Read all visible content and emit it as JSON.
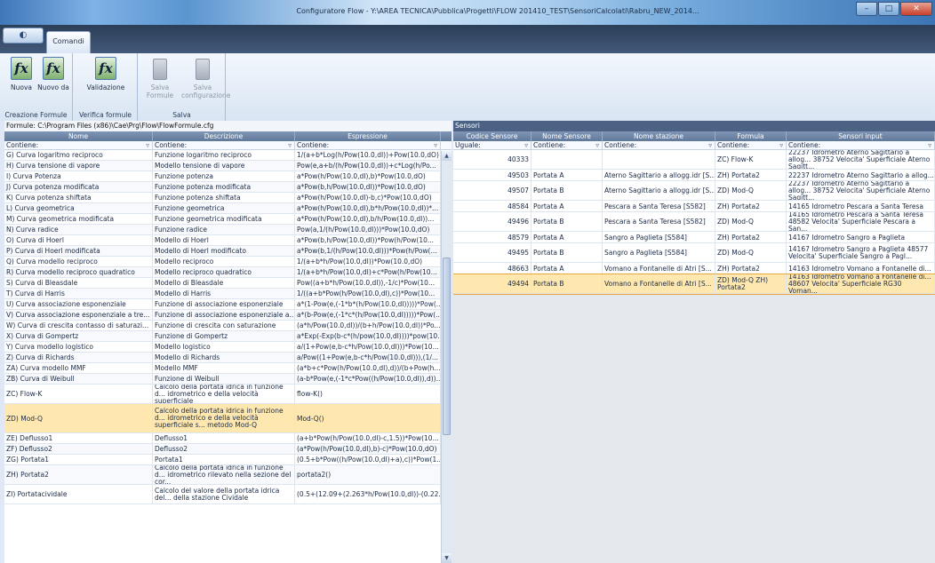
{
  "window": {
    "title": "Configuratore Flow - Y:\\AREA TECNICA\\Pubblica\\Progetti\\FLOW 201410_TEST\\SensoriCalcolati\\Rabru_NEW_2014...",
    "minimize": "–",
    "maximize": "□",
    "close": "✕"
  },
  "tabs": {
    "orb": "◐",
    "comandi": "Comandi"
  },
  "ribbon": {
    "groups": [
      {
        "label": "Creazione Formule",
        "buttons": [
          "Nuova",
          "Nuovo da"
        ]
      },
      {
        "label": "Verifica formule",
        "buttons": [
          "Validazione"
        ]
      },
      {
        "label": "Salva",
        "buttons": [
          "Salva Formule",
          "Salva configurazione"
        ]
      }
    ],
    "icon_glyph": "fx"
  },
  "left": {
    "path": "Formule: C:\\Program Files (x86)\\Cae\\Prg\\Flow\\FlowFormule.cfg",
    "columns": [
      "Nome",
      "Descrizione",
      "Espressione"
    ],
    "filter": "Contiene:",
    "rows": [
      {
        "nome": "G) Curva logaritmo reciproco",
        "desc": "Funzione logaritmo reciproco",
        "expr": "1/(a+b*Log(h/Pow(10.0,dI))+Pow(10.0,dO)"
      },
      {
        "nome": "H) Curva tensione di vapore",
        "desc": "Modello tensione di vapore",
        "expr": "Pow(e,a+b/(h/Pow(10.0,dI))+c*Log(h/Po..."
      },
      {
        "nome": "I) Curva Potenza",
        "desc": "Funzione potenza",
        "expr": "a*Pow(h/Pow(10.0,dI),b)*Pow(10.0,dO)"
      },
      {
        "nome": "J) Curva potenza modificata",
        "desc": "Funzione potenza modificata",
        "expr": "a*Pow(b,h/Pow(10.0,dI))*Pow(10.0,dO)"
      },
      {
        "nome": "K) Curva potenza shiftata",
        "desc": "Funzione potenza shiftata",
        "expr": "a*Pow(h/Pow(10.0,dI)-b,c)*Pow(10.0,dO)"
      },
      {
        "nome": "L) Curva geometrica",
        "desc": "Funzione geometrica",
        "expr": "a*Pow(h/Pow(10.0,dI),b*h/Pow(10.0,dI))*..."
      },
      {
        "nome": "M) Curva geometrica modificata",
        "desc": "Funzione geometrica modificata",
        "expr": "a*Pow(h/Pow(10.0,dI),b/h/Pow(10.0,dI))..."
      },
      {
        "nome": "N) Curva radice",
        "desc": "Funzione radice",
        "expr": "Pow(a,1/(h/Pow(10.0,dI)))*Pow(10.0,dO)"
      },
      {
        "nome": "O) Curva di Hoerl",
        "desc": "Modello di Hoerl",
        "expr": "a*Pow(b,h/Pow(10.0,dI))*Pow(h/Pow(10..."
      },
      {
        "nome": "P) Curva di Hoerl modificata",
        "desc": "Modello di Hoerl modificato",
        "expr": "a*Pow(b,1/(h/Pow(10.0,dI)))*Pow(h/Pow(..."
      },
      {
        "nome": "Q) Curva modello reciproco",
        "desc": "Modello reciproco",
        "expr": "1/(a+b*h/Pow(10.0,dI))*Pow(10.0,dO)"
      },
      {
        "nome": "R) Curva modello reciproco quadratico",
        "desc": "Modello reciproco quadratico",
        "expr": "1/(a+b*h/Pow(10.0,dI)+c*Pow(h/Pow(10..."
      },
      {
        "nome": "S) Curva di Bleasdale",
        "desc": "Modello di Bleasdale",
        "expr": "Pow((a+b*h/Pow(10.0,dI)),-1/c)*Pow(10..."
      },
      {
        "nome": "T) Curva di Harris",
        "desc": "Modello di Harris",
        "expr": "1/((a+b*Pow(h/Pow(10.0,dI),c))*Pow(10..."
      },
      {
        "nome": "U) Curva associazione esponenziale",
        "desc": "Funzione di associazione esponenziale",
        "expr": "a*(1-Pow(e,(-1*b*(h/Pow(10.0,dI)))))*Pow(..."
      },
      {
        "nome": "V) Curva associazione esponenziale a tre...",
        "desc": "Funzione di associazione esponenziale a...",
        "expr": "a*(b-Pow(e,(-1*c*(h/Pow(10.0,dI)))))*Pow(..."
      },
      {
        "nome": "W) Curva di crescita contasso di saturazi...",
        "desc": "Funzione di crescita con saturazione",
        "expr": "(a*h/Pow(10.0,dI))/(b+h/Pow(10.0,dI))*Po..."
      },
      {
        "nome": "X) Curva di Gompertz",
        "desc": "Funzione di Gompertz",
        "expr": "a*Exp(-Exp(b-c*(h/pow(10.0,dI))))*pow(10..."
      },
      {
        "nome": "Y) Curva modello logistico",
        "desc": "Modello logistico",
        "expr": "a/(1+Pow(e,b-c*h/Pow(10.0,dI)))*Pow(10..."
      },
      {
        "nome": "Z) Curva di Richards",
        "desc": "Modello di Richards",
        "expr": "a/Pow((1+Pow(e,b-c*h/Pow(10.0,dI))),(1/..."
      },
      {
        "nome": "ZA) Curva modello MMF",
        "desc": "Modello MMF",
        "expr": "(a*b+c*Pow(h/Pow(10.0,dI),d))/(b+Pow(h..."
      },
      {
        "nome": "ZB) Curva di Weibull",
        "desc": "Funzione di Weibull",
        "expr": "(a-b*Pow(e,(-1*c*Pow((h/Pow(10.0,dI)),d))..."
      },
      {
        "nome": "ZC) Flow-K",
        "desc": "Calcolo della portata idrica in funzione d... idrometrico e della velocità superficiale",
        "expr": "flow-K()",
        "tall": 2
      },
      {
        "nome": "ZD) Mod-Q",
        "desc": "Calcolo della portata idrica in funzione d... idrometrico e della velocità superficiale s... metodo Mod-Q",
        "expr": "Mod-Q()",
        "tall": 3,
        "sel": true
      },
      {
        "nome": "ZE) Deflusso1",
        "desc": "Deflusso1",
        "expr": "(a+b*Pow(h/Pow(10.0,dI)-c,1.5))*Pow(10..."
      },
      {
        "nome": "ZF) Deflusso2",
        "desc": "Deflusso2",
        "expr": "(a*Pow(h/Pow(10.0,dI),b)-c)*Pow(10.0,dO)"
      },
      {
        "nome": "ZG) Portata1",
        "desc": "Portata1",
        "expr": "(0.5+b*Pow((h/Pow(10.0,dI)+a),c))*Pow(1..."
      },
      {
        "nome": "ZH) Portata2",
        "desc": "Calcolo della portata idrica in funzione d... idrometrico rilevato nella sezione del cor...",
        "expr": "portata2()",
        "tall": 2
      },
      {
        "nome": "ZI) Portatacividale",
        "desc": "Calcolo del valore della portata idrica del... della stazione Cividale",
        "expr": "(0.5+(12.09+(2.263*h/Pow(10.0,dI))-(0.22...",
        "tall": 2
      }
    ]
  },
  "right": {
    "title": "Sensori",
    "columns": [
      "Codice Sensore",
      "Nome Sensore",
      "Nome stazione",
      "Formula",
      "Sensori input"
    ],
    "filter": [
      "Uguale:",
      "Contiene:",
      "Contiene:",
      "Contiene:",
      "Contiene:"
    ],
    "rows": [
      {
        "code": "40333",
        "nome": "",
        "stazione": "",
        "formula": "ZC) Flow-K",
        "input": "22237 Idrometro Aterno Sagittario a allog... 38752 Velocita' Superficiale Aterno Sagitt..."
      },
      {
        "code": "49503",
        "nome": "Portata A",
        "stazione": "Aterno Sagittario a allogg.idr [S...",
        "formula": "ZH) Portata2",
        "input": "22237 Idrometro Aterno Sagittario a allog..."
      },
      {
        "code": "49507",
        "nome": "Portata B",
        "stazione": "Aterno Sagittario a allogg.idr [S...",
        "formula": "ZD) Mod-Q",
        "input": "22237 Idrometro Aterno Sagittario a allog... 38752 Velocita' Superficiale Aterno Sagitt..."
      },
      {
        "code": "48584",
        "nome": "Portata A",
        "stazione": "Pescara a Santa Teresa [S582]",
        "formula": "ZH) Portata2",
        "input": "14165 Idrometro Pescara a Santa Teresa"
      },
      {
        "code": "49496",
        "nome": "Portata B",
        "stazione": "Pescara a Santa Teresa [S582]",
        "formula": "ZD) Mod-Q",
        "input": "14165 Idrometro Pescara a Santa Teresa 48582 Velocita' Superficiale Pescara a San..."
      },
      {
        "code": "48579",
        "nome": "Portata A",
        "stazione": "Sangro a Paglieta [S584]",
        "formula": "ZH) Portata2",
        "input": "14167 Idrometro Sangro a Paglieta"
      },
      {
        "code": "49495",
        "nome": "Portata B",
        "stazione": "Sangro a Paglieta [S584]",
        "formula": "ZD) Mod-Q",
        "input": "14167 Idrometro Sangro a Paglieta 48577 Velocita' Superficiale Sangro a Pagl..."
      },
      {
        "code": "48663",
        "nome": "Portata A",
        "stazione": "Vomano a Fontanelle di Atri [S...",
        "formula": "ZH) Portata2",
        "input": "14163 Idrometro Vomano a Fontanelle di..."
      },
      {
        "code": "49494",
        "nome": "Portata B",
        "stazione": "Vomano a Fontanelle di Atri [S...",
        "formula": "ZD) Mod-Q ZH) Portata2",
        "input": "14163 Idrometro Vomano a Fontanelle di... 48607 Velocita' Superficiale RG30 Voman...",
        "sel": true
      }
    ]
  },
  "colors": {
    "accent": "#4b6285",
    "selection": "#ffe8b0",
    "header": "#6a82a5"
  }
}
